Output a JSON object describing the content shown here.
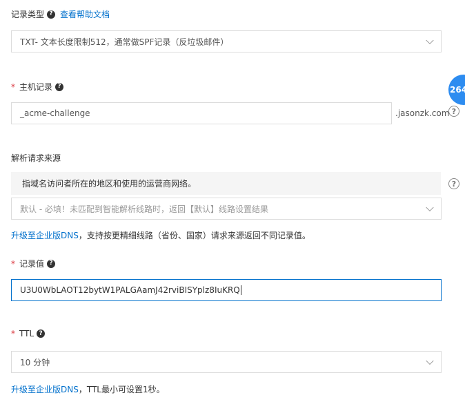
{
  "record_type": {
    "label": "记录类型",
    "help_link": "查看帮助文档",
    "selected": "TXT- 文本长度限制512，通常做SPF记录（反垃圾邮件）"
  },
  "host_record": {
    "required_mark": "*",
    "label": "主机记录",
    "value": "_acme-challenge",
    "suffix": ".jasonzk.com"
  },
  "line": {
    "label": "解析请求来源",
    "hint": "指域名访问者所在的地区和使用的运营商网络。",
    "selected": "默认 - 必填！未匹配到智能解析线路时，返回【默认】线路设置结果",
    "upgrade_link": "升级至企业版DNS",
    "upgrade_text": "，支持按更精细线路（省份、国家）请求来源返回不同记录值。"
  },
  "record_value": {
    "required_mark": "*",
    "label": "记录值",
    "value": "U3U0WbLAOT12bytW1PALGAamJ42rviBISYplz8IuKRQ"
  },
  "ttl": {
    "required_mark": "*",
    "label": "TTL",
    "selected": "10 分钟",
    "upgrade_link": "升级至企业版DNS",
    "upgrade_text": "，TTL最小可设置1秒。"
  },
  "help_icon_glyph": "?",
  "help_circle_glyph": "?",
  "badge": {
    "text": "264",
    "color": "#2d8cf0"
  },
  "colors": {
    "link": "#0070cc",
    "required": "#d9363e",
    "focus_border": "#0070cc"
  }
}
